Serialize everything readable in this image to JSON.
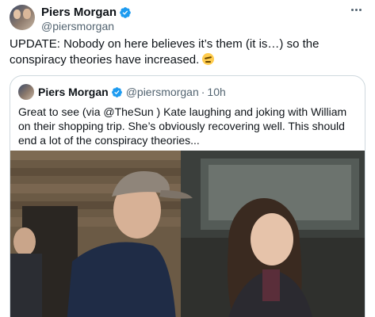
{
  "tweet": {
    "display_name": "Piers Morgan",
    "handle": "@piersmorgan",
    "text": "UPDATE: Nobody on here believes it’s them (it is…) so the conspiracy theories have increased.",
    "emoji": "face-with-rolling-eyes"
  },
  "quoted": {
    "display_name": "Piers Morgan",
    "handle": "@piersmorgan",
    "separator": "·",
    "time": "10h",
    "text": "Great to see (via @TheSun ) Kate laughing and joking with William on their shopping trip. She’s obviously recovering well. This should end a lot of the conspiracy theories..."
  },
  "icons": {
    "verified": "verified-badge-icon",
    "more": "more-options-icon"
  },
  "colors": {
    "verified_blue": "#1d9bf0",
    "secondary_text": "#536471",
    "border": "#cfd9de"
  }
}
